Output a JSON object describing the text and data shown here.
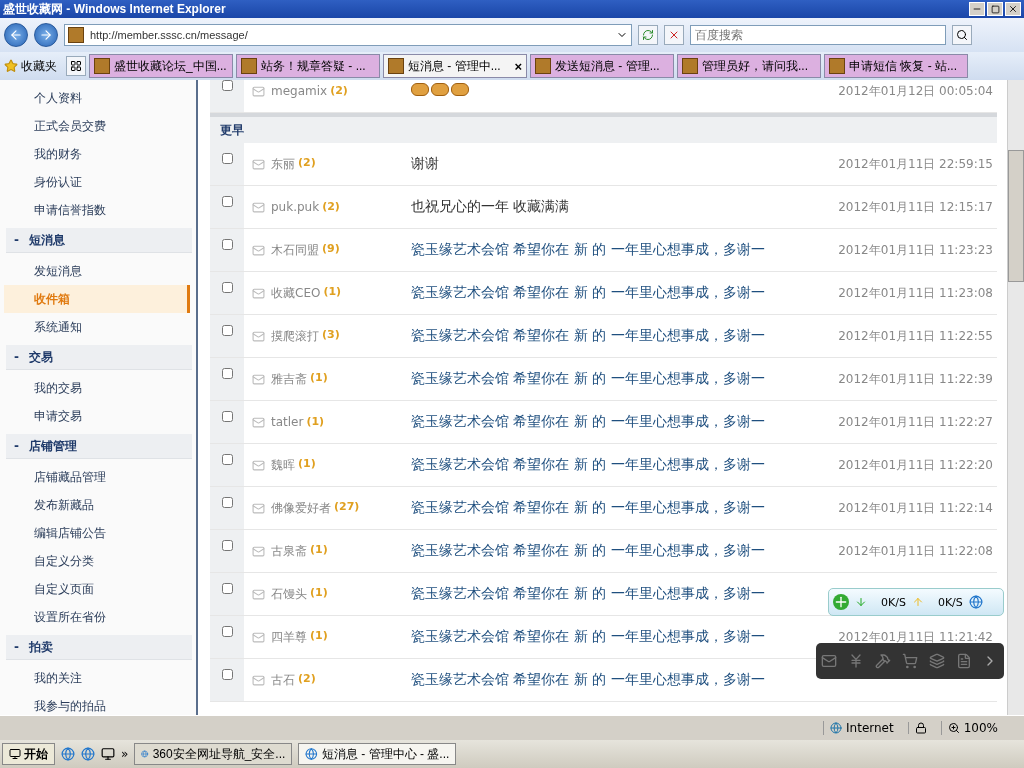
{
  "window": {
    "title": "盛世收藏网 - Windows Internet Explorer"
  },
  "address": {
    "value": "http://member.sssc.cn/message/"
  },
  "search": {
    "placeholder": "百度搜索"
  },
  "favorites": {
    "label": "收藏夹"
  },
  "tabs": [
    {
      "label": "盛世收藏论坛_中国...",
      "selected": false
    },
    {
      "label": "站务！规章答疑 - ...",
      "selected": false
    },
    {
      "label": "短消息 - 管理中...",
      "selected": true,
      "close": "×"
    },
    {
      "label": "发送短消息 - 管理...",
      "selected": false
    },
    {
      "label": "管理员好，请问我...",
      "selected": false
    },
    {
      "label": "申请短信 恢复 - 站...",
      "selected": false
    }
  ],
  "sidebar": {
    "groups": [
      {
        "items": [
          {
            "label": "个人资料",
            "selected": false
          },
          {
            "label": "正式会员交费",
            "selected": false
          },
          {
            "label": "我的财务",
            "selected": false
          },
          {
            "label": "身份认证",
            "selected": false
          },
          {
            "label": "申请信誉指数",
            "selected": false
          }
        ]
      },
      {
        "heading": "短消息",
        "toggle": "-",
        "items": [
          {
            "label": "发短消息",
            "selected": false
          },
          {
            "label": "收件箱",
            "selected": true
          },
          {
            "label": "系统通知",
            "selected": false
          }
        ]
      },
      {
        "heading": "交易",
        "toggle": "-",
        "items": [
          {
            "label": "我的交易",
            "selected": false
          },
          {
            "label": "申请交易",
            "selected": false
          }
        ]
      },
      {
        "heading": "店铺管理",
        "toggle": "-",
        "items": [
          {
            "label": "店铺藏品管理",
            "selected": false
          },
          {
            "label": "发布新藏品",
            "selected": false
          },
          {
            "label": "编辑店铺公告",
            "selected": false
          },
          {
            "label": "自定义分类",
            "selected": false
          },
          {
            "label": "自定义页面",
            "selected": false
          },
          {
            "label": "设置所在省份",
            "selected": false
          }
        ]
      },
      {
        "heading": "拍卖",
        "toggle": "-",
        "items": [
          {
            "label": "我的关注",
            "selected": false
          },
          {
            "label": "我参与的拍品",
            "selected": false
          }
        ]
      }
    ]
  },
  "messages": {
    "sections": [
      {
        "rows": [
          {
            "sender": "megamix",
            "count": "(2)",
            "kind": "smileys",
            "time": "2012年01月12日 00:05:04",
            "checked": false
          }
        ]
      },
      {
        "heading": "更早",
        "rows": [
          {
            "sender": "东丽",
            "count": "(2)",
            "kind": "text",
            "subject": "谢谢",
            "time": "2012年01月11日 22:59:15",
            "checked": false
          },
          {
            "sender": "puk.puk",
            "count": "(2)",
            "kind": "text",
            "subject": "也祝兄心的一年 收藏满满",
            "time": "2012年01月11日 12:15:17",
            "checked": false
          },
          {
            "sender": "木石同盟",
            "count": "(9)",
            "kind": "link",
            "subject": "瓷玉缘艺术会馆 希望你在 新 的 一年里心想事成，多谢一",
            "time": "2012年01月11日 11:23:23",
            "checked": false
          },
          {
            "sender": "收藏CEO",
            "count": "(1)",
            "kind": "link",
            "subject": "瓷玉缘艺术会馆 希望你在 新 的 一年里心想事成，多谢一",
            "time": "2012年01月11日 11:23:08",
            "checked": false
          },
          {
            "sender": "摸爬滚打",
            "count": "(3)",
            "kind": "link",
            "subject": "瓷玉缘艺术会馆 希望你在 新 的 一年里心想事成，多谢一",
            "time": "2012年01月11日 11:22:55",
            "checked": false
          },
          {
            "sender": "雅吉斋",
            "count": "(1)",
            "kind": "link",
            "subject": "瓷玉缘艺术会馆 希望你在 新 的 一年里心想事成，多谢一",
            "time": "2012年01月11日 11:22:39",
            "checked": false
          },
          {
            "sender": "tatler",
            "count": "(1)",
            "kind": "link",
            "subject": "瓷玉缘艺术会馆 希望你在 新 的 一年里心想事成，多谢一",
            "time": "2012年01月11日 11:22:27",
            "checked": false
          },
          {
            "sender": "魏晖",
            "count": "(1)",
            "kind": "link",
            "subject": "瓷玉缘艺术会馆 希望你在 新 的 一年里心想事成，多谢一",
            "time": "2012年01月11日 11:22:20",
            "checked": false
          },
          {
            "sender": "佛像爱好者",
            "count": "(27)",
            "kind": "link",
            "subject": "瓷玉缘艺术会馆 希望你在 新 的 一年里心想事成，多谢一",
            "time": "2012年01月11日 11:22:14",
            "checked": false
          },
          {
            "sender": "古泉斋",
            "count": "(1)",
            "kind": "link",
            "subject": "瓷玉缘艺术会馆 希望你在 新 的 一年里心想事成，多谢一",
            "time": "2012年01月11日 11:22:08",
            "checked": false
          },
          {
            "sender": "石馒头",
            "count": "(1)",
            "kind": "link",
            "subject": "瓷玉缘艺术会馆 希望你在 新 的 一年里心想事成，多谢一",
            "checked": false
          },
          {
            "sender": "四羊尊",
            "count": "(1)",
            "kind": "link",
            "subject": "瓷玉缘艺术会馆 希望你在 新 的 一年里心想事成，多谢一",
            "time": "2012年01月11日 11:21:42",
            "checked": false
          },
          {
            "sender": "古石",
            "count": "(2)",
            "kind": "link",
            "subject": "瓷玉缘艺术会馆 希望你在 新 的 一年里心想事成，多谢一",
            "checked": false
          }
        ]
      }
    ]
  },
  "speed_widget": {
    "down": "0K/S",
    "up": "0K/S"
  },
  "status_bar": {
    "zone": "Internet",
    "zoom": "100%"
  },
  "taskbar": {
    "start": "开始",
    "more": "»",
    "tasks": [
      {
        "label": "360安全网址导航_安全...",
        "selected": false
      },
      {
        "label": "短消息 - 管理中心 - 盛...",
        "selected": true
      }
    ]
  }
}
